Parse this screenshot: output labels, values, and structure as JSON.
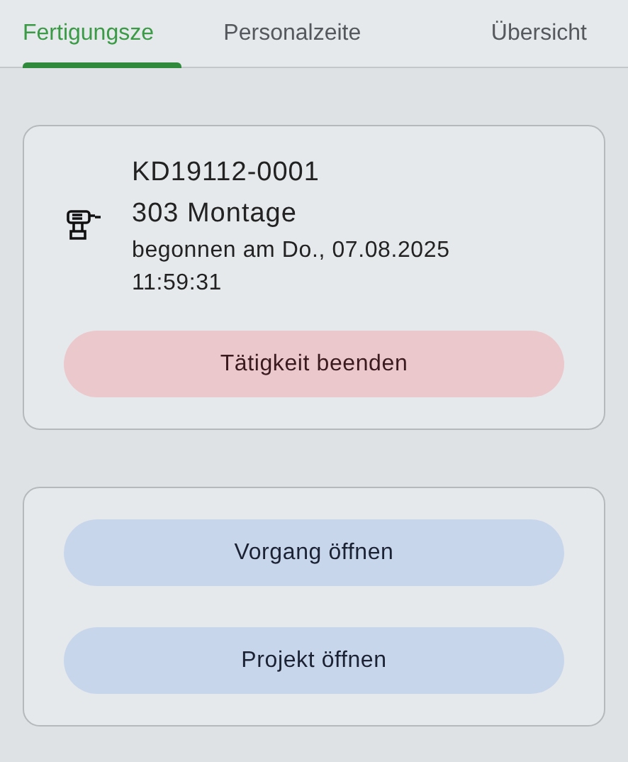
{
  "tabs": [
    {
      "label": "Fertigungsze",
      "selected": true
    },
    {
      "label": "Personalzeite",
      "selected": false
    },
    {
      "label": "Übersicht",
      "selected": false
    }
  ],
  "activity": {
    "order": "KD19112-0001",
    "operation": "303 Montage",
    "started": "begonnen am Do., 07.08.2025 11:59:31",
    "button": {
      "label": "Tätigkeit beenden",
      "kind": "danger"
    }
  },
  "actions": [
    {
      "label": "Vorgang öffnen",
      "kind": "primary"
    },
    {
      "label": "Projekt öffnen",
      "kind": "primary"
    }
  ]
}
